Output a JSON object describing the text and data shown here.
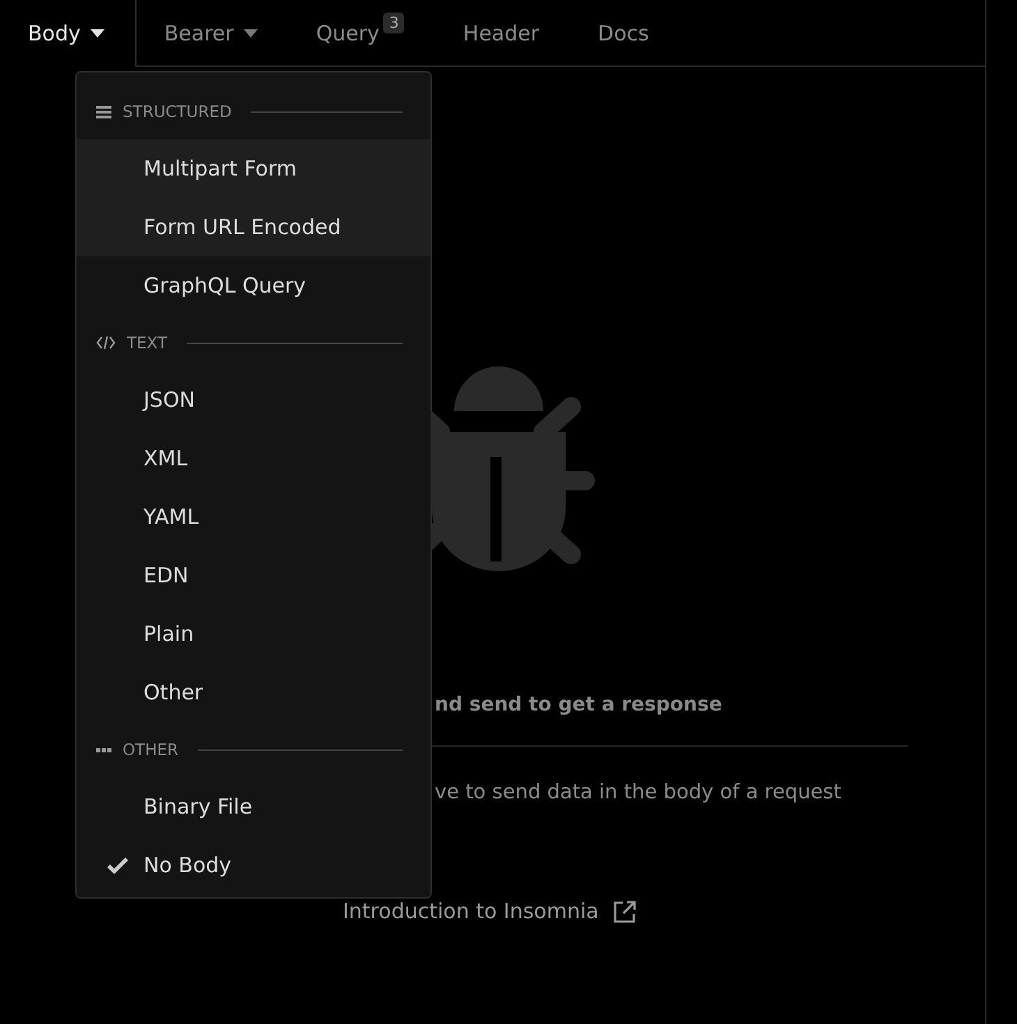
{
  "tabs": [
    {
      "label": "Body",
      "selected": true,
      "caret": true
    },
    {
      "label": "Bearer",
      "selected": false,
      "caret": true
    },
    {
      "label": "Query",
      "selected": false,
      "badge": "3"
    },
    {
      "label": "Header",
      "selected": false
    },
    {
      "label": "Docs",
      "selected": false
    }
  ],
  "menu": {
    "sections": [
      {
        "kind": "structured",
        "label": "STRUCTURED",
        "items": [
          {
            "label": "Multipart Form",
            "highlighted": true,
            "checked": false
          },
          {
            "label": "Form URL Encoded",
            "highlighted": true,
            "checked": false
          },
          {
            "label": "GraphQL Query",
            "highlighted": false,
            "checked": false
          }
        ]
      },
      {
        "kind": "text",
        "label": "TEXT",
        "items": [
          {
            "label": "JSON",
            "highlighted": false,
            "checked": false
          },
          {
            "label": "XML",
            "highlighted": false,
            "checked": false
          },
          {
            "label": "YAML",
            "highlighted": false,
            "checked": false
          },
          {
            "label": "EDN",
            "highlighted": false,
            "checked": false
          },
          {
            "label": "Plain",
            "highlighted": false,
            "checked": false
          },
          {
            "label": "Other",
            "highlighted": false,
            "checked": false
          }
        ]
      },
      {
        "kind": "other",
        "label": "OTHER",
        "items": [
          {
            "label": "Binary File",
            "highlighted": false,
            "checked": false
          },
          {
            "label": "No Body",
            "highlighted": false,
            "checked": true
          }
        ]
      }
    ]
  },
  "empty_state": {
    "title": "nd send to get a response",
    "hint": "ve to send data in the body of a request",
    "link": "Introduction to Insomnia"
  }
}
